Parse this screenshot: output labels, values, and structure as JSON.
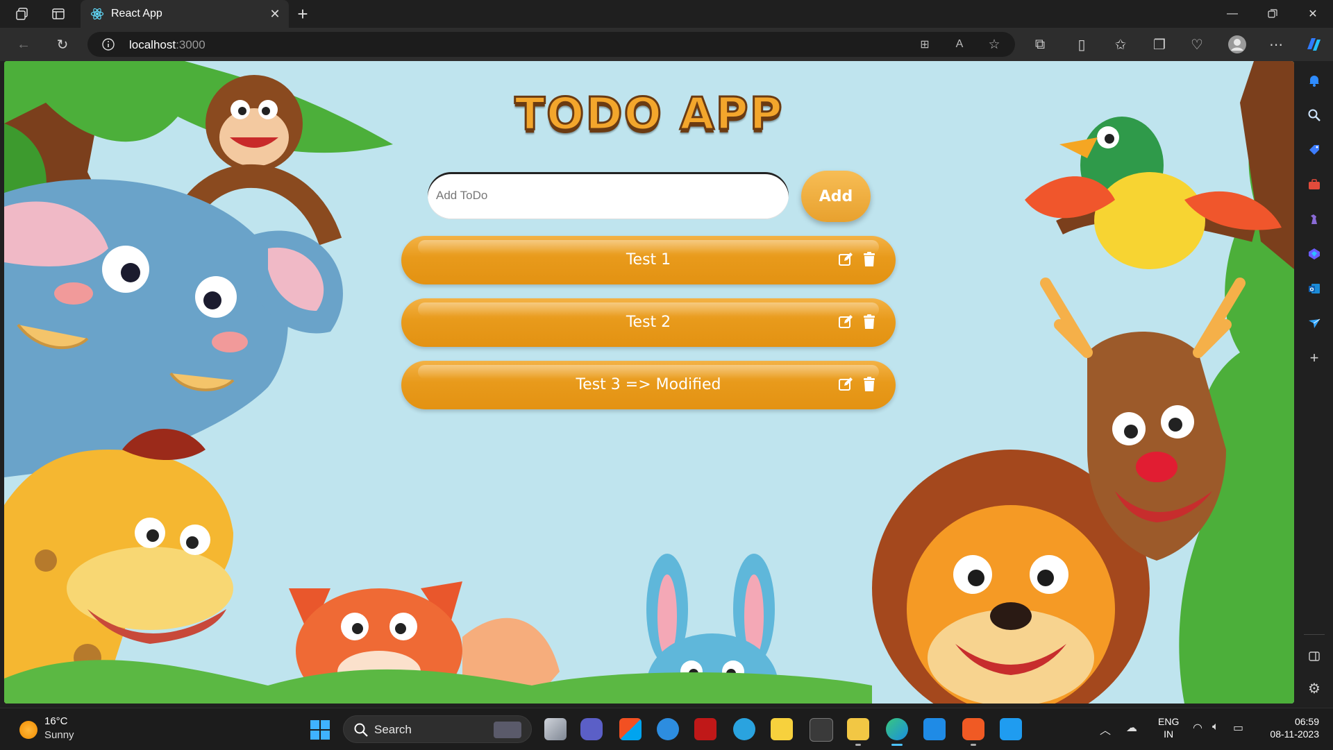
{
  "browser": {
    "tab_title": "React App",
    "url_host": "localhost",
    "url_port": ":3000"
  },
  "app": {
    "title": "TODO APP",
    "input_placeholder": "Add ToDo",
    "add_label": "Add",
    "todos": [
      {
        "text": "Test 1"
      },
      {
        "text": "Test 2"
      },
      {
        "text": "Test 3 => Modified"
      }
    ]
  },
  "taskbar": {
    "weather_temp": "16°C",
    "weather_cond": "Sunny",
    "search_label": "Search",
    "lang_line1": "ENG",
    "lang_line2": "IN",
    "time": "06:59",
    "date": "08-11-2023"
  },
  "colors": {
    "todo_orange": "#e89a1b",
    "sky_background": "#bfe4ee",
    "accent_blue": "#4cc2ff"
  }
}
